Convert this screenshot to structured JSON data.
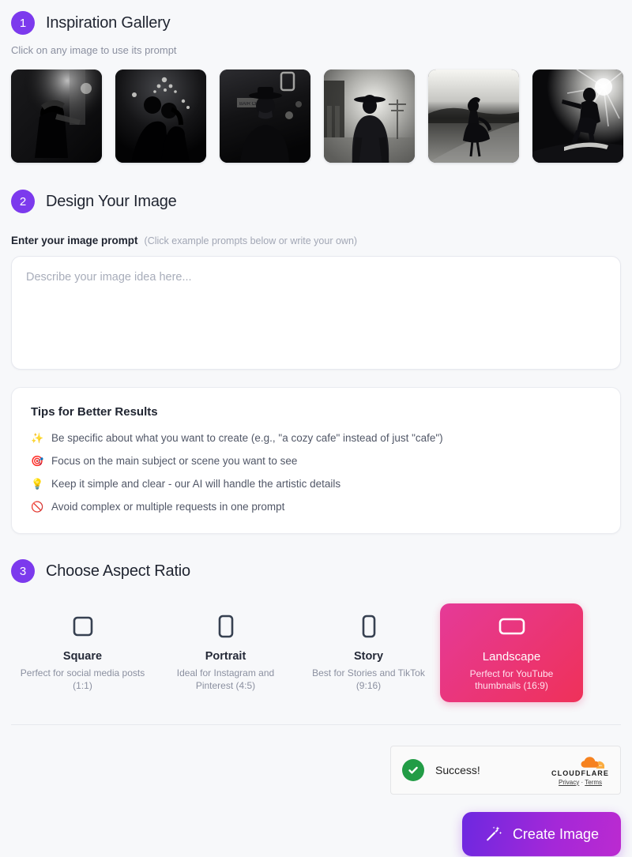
{
  "sections": {
    "gallery": {
      "step": "1",
      "title": "Inspiration Gallery",
      "subtitle": "Click on any image to use its prompt",
      "images": [
        {
          "alt": "violinist in dark alley",
          "scene": "violinist"
        },
        {
          "alt": "couple embracing under chandelier",
          "scene": "couple"
        },
        {
          "alt": "detective in hat on noir street",
          "scene": "detective",
          "sign": "BAIR CRTY"
        },
        {
          "alt": "cowboy silhouette in foggy town",
          "scene": "cowboy"
        },
        {
          "alt": "woman in dress twirling on road",
          "scene": "dancer"
        },
        {
          "alt": "skateboarder backlit by sun",
          "scene": "skater"
        }
      ]
    },
    "design": {
      "step": "2",
      "title": "Design Your Image",
      "prompt_label": "Enter your image prompt",
      "prompt_hint": "(Click example prompts below or write your own)",
      "prompt_value": "",
      "prompt_placeholder": "Describe your image idea here...",
      "tips": {
        "title": "Tips for Better Results",
        "items": [
          {
            "icon": "sparkles-icon",
            "emoji": "✨",
            "text": "Be specific about what you want to create (e.g., \"a cozy cafe\" instead of just \"cafe\")"
          },
          {
            "icon": "target-icon",
            "emoji": "🎯",
            "text": "Focus on the main subject or scene you want to see"
          },
          {
            "icon": "lightbulb-icon",
            "emoji": "💡",
            "text": "Keep it simple and clear - our AI will handle the artistic details"
          },
          {
            "icon": "prohibited-icon",
            "emoji": "🚫",
            "text": "Avoid complex or multiple requests in one prompt"
          }
        ]
      }
    },
    "aspect": {
      "step": "3",
      "title": "Choose Aspect Ratio",
      "selected": "Landscape",
      "options": [
        {
          "name": "Square",
          "desc": "Perfect for social media posts (1:1)",
          "ratio": "1:1",
          "icon": "square-outline-icon",
          "selected": false
        },
        {
          "name": "Portrait",
          "desc": "Ideal for Instagram and Pinterest (4:5)",
          "ratio": "4:5",
          "icon": "portrait-rect-outline-icon",
          "selected": false
        },
        {
          "name": "Story",
          "desc": "Best for Stories and TikTok (9:16)",
          "ratio": "9:16",
          "icon": "tall-rect-outline-icon",
          "selected": false
        },
        {
          "name": "Landscape",
          "desc": "Perfect for YouTube thumbnails (16:9)",
          "ratio": "16:9",
          "icon": "landscape-rect-outline-icon",
          "selected": true
        }
      ]
    }
  },
  "turnstile": {
    "status": "Success!",
    "brand": "CLOUDFLARE",
    "privacy": "Privacy",
    "separator": "·",
    "terms": "Terms",
    "check_icon": "check-circle-icon",
    "logo_icon": "cloudflare-cloud-icon"
  },
  "actions": {
    "create_label": "Create Image",
    "create_icon": "magic-wand-icon"
  },
  "colors": {
    "accent_purple": "#7c3aed",
    "page_bg": "#f7f8fa",
    "card_bg": "#ffffff",
    "selected_gradient_from": "#e53a98",
    "selected_gradient_to": "#ef3159",
    "button_gradient_from": "#6d28e0",
    "button_gradient_to": "#bb2ad0",
    "success_green": "#229c46",
    "cloudflare_orange": "#f38020"
  }
}
